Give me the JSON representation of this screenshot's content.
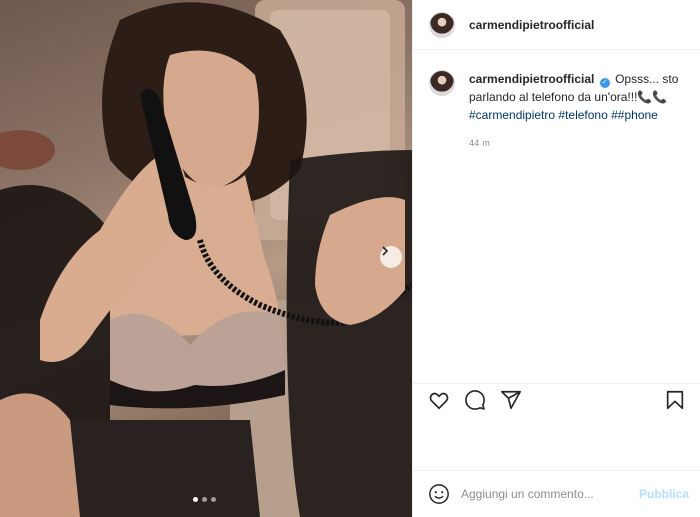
{
  "header": {
    "username": "carmendipietroofficial"
  },
  "caption": {
    "username": "carmendipietroofficial",
    "verified_icon": "verified-badge-icon",
    "text": "Opsss... sto parlando al telefono da un'ora!!!",
    "emoji": "📞📞",
    "hashtags": [
      "#carmendipietro",
      "#telefono",
      "##phone"
    ],
    "time": "44 m"
  },
  "actions": {
    "icons": [
      "heart-icon",
      "comment-icon",
      "share-icon",
      "bookmark-icon"
    ]
  },
  "add_comment": {
    "placeholder": "Aggiungi un commento...",
    "publish_label": "Pubblica"
  },
  "carousel": {
    "slide_count": 3,
    "active_slide": 1
  },
  "colors": {
    "link": "#00376b",
    "verified": "#3897f0",
    "publish": "#b2dffc",
    "muted": "#8e8e8e"
  }
}
